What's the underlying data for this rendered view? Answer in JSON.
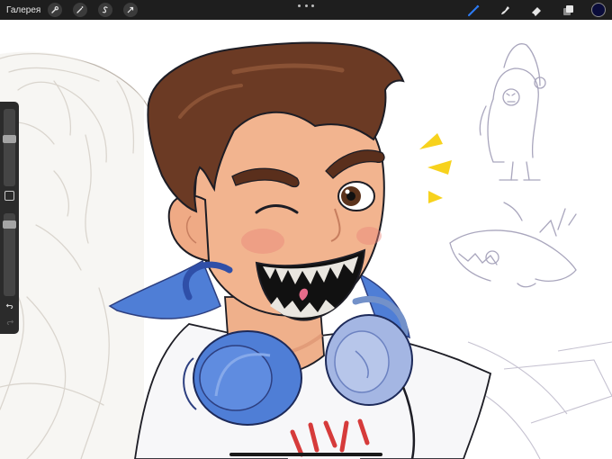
{
  "topbar": {
    "gallery_label": "Галерея",
    "left_tools": [
      {
        "icon": "wrench-icon"
      },
      {
        "icon": "magic-wand-icon"
      },
      {
        "icon": "selection-icon"
      },
      {
        "icon": "transform-arrow-icon"
      }
    ],
    "right_tools": [
      {
        "icon": "brush-icon",
        "active": true
      },
      {
        "icon": "smudge-icon"
      },
      {
        "icon": "eraser-icon"
      },
      {
        "icon": "layers-icon"
      }
    ],
    "current_color": "#0a0c3a"
  },
  "sidebar": {
    "brush_size_level": 0.62,
    "opacity_level": 0.1
  },
  "colors": {
    "accent_blue": "#2d7bf4",
    "headphone_blue": "#4f7ed6",
    "hair": "#6b3a24",
    "skin": "#f2b48f",
    "sketch": "#b6aea4"
  }
}
